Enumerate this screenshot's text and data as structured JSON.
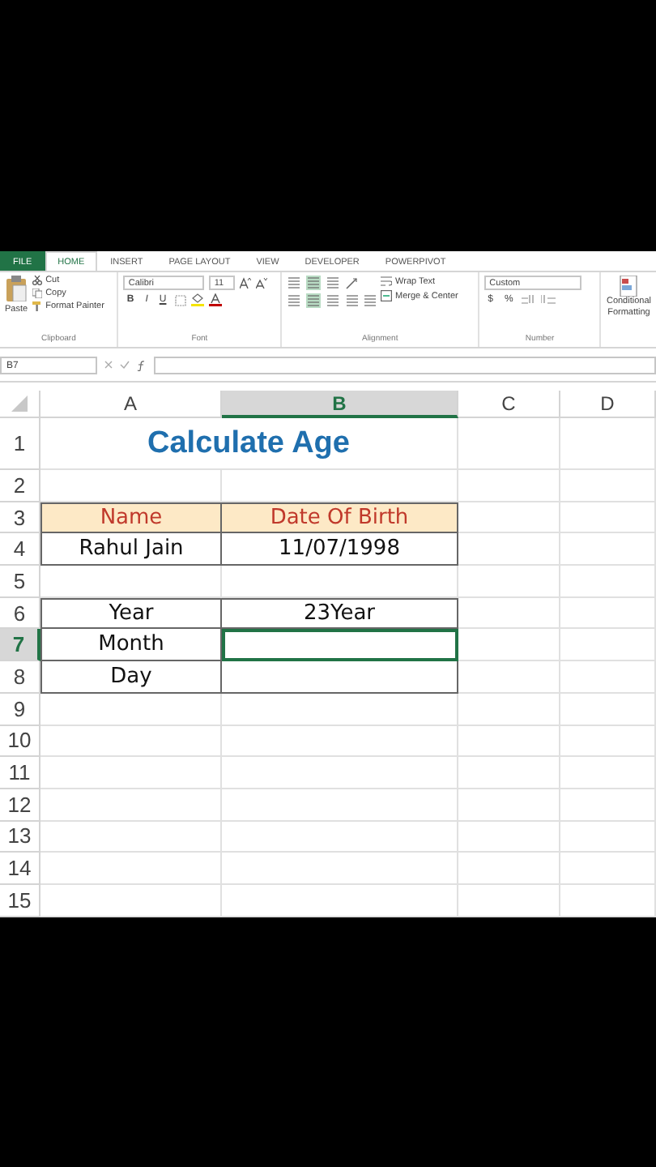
{
  "ribbon": {
    "tabs": [
      {
        "label": "FILE",
        "kind": "file",
        "selected": false
      },
      {
        "label": "HOME",
        "kind": "tab",
        "selected": true
      },
      {
        "label": "INSERT",
        "kind": "tab",
        "selected": false
      },
      {
        "label": "PAGE LAYOUT",
        "kind": "tab",
        "selected": false
      },
      {
        "label": "VIEW",
        "kind": "tab",
        "selected": false
      },
      {
        "label": "DEVELOPER",
        "kind": "tab",
        "selected": false
      },
      {
        "label": "POWERPIVOT",
        "kind": "tab",
        "selected": false
      }
    ],
    "clipboard": {
      "paste": "Paste",
      "cut": "Cut",
      "copy": "Copy",
      "format_painter": "Format Painter",
      "label": "Clipboard"
    },
    "font": {
      "name": "Calibri",
      "size": "11",
      "bold": "B",
      "italic": "I",
      "underline": "U",
      "label": "Font"
    },
    "alignment": {
      "wrap_text": "Wrap Text",
      "merge": "Merge & Center",
      "label": "Alignment"
    },
    "number": {
      "format": "Custom",
      "currency": "$",
      "percent": "%",
      "label": "Number"
    },
    "styles": {
      "conditional": "Conditional Formatting"
    }
  },
  "formula_bar": {
    "name_box": "B7"
  },
  "sheet": {
    "columns": [
      {
        "label": "A",
        "selected": false
      },
      {
        "label": "B",
        "selected": true
      },
      {
        "label": "C",
        "selected": false
      },
      {
        "label": "D",
        "selected": false
      }
    ],
    "rows": [
      {
        "number": "1",
        "selected": false,
        "kind": "title",
        "cells": [
          {
            "text": "Calculate Age",
            "selected": false
          }
        ]
      },
      {
        "number": "2",
        "selected": false,
        "kind": "plain",
        "cells": []
      },
      {
        "number": "3",
        "selected": false,
        "kind": "header",
        "cells": [
          {
            "text": "Name",
            "selected": false
          },
          {
            "text": "Date Of Birth",
            "selected": false
          }
        ]
      },
      {
        "number": "4",
        "selected": false,
        "kind": "bordered",
        "cells": [
          {
            "text": "Rahul Jain",
            "selected": false
          },
          {
            "text": "11/07/1998",
            "selected": false
          }
        ]
      },
      {
        "number": "5",
        "selected": false,
        "kind": "plain",
        "cells": []
      },
      {
        "number": "6",
        "selected": false,
        "kind": "bordered",
        "cells": [
          {
            "text": "Year",
            "selected": false
          },
          {
            "text": "23Year",
            "selected": false
          }
        ]
      },
      {
        "number": "7",
        "selected": true,
        "kind": "bordered",
        "cells": [
          {
            "text": "Month",
            "selected": false
          },
          {
            "selected": true
          }
        ]
      },
      {
        "number": "8",
        "selected": false,
        "kind": "bordered",
        "cells": [
          {
            "text": "Day",
            "selected": false
          },
          {
            "selected": false
          }
        ]
      },
      {
        "number": "9",
        "selected": false,
        "kind": "plain",
        "cells": []
      },
      {
        "number": "10",
        "selected": false,
        "kind": "plain",
        "cells": []
      },
      {
        "number": "11",
        "selected": false,
        "kind": "plain",
        "cells": []
      },
      {
        "number": "12",
        "selected": false,
        "kind": "plain",
        "cells": []
      },
      {
        "number": "13",
        "selected": false,
        "kind": "plain",
        "cells": []
      },
      {
        "number": "14",
        "selected": false,
        "kind": "plain",
        "cells": []
      },
      {
        "number": "15",
        "selected": false,
        "kind": "plain",
        "cells": []
      }
    ]
  }
}
